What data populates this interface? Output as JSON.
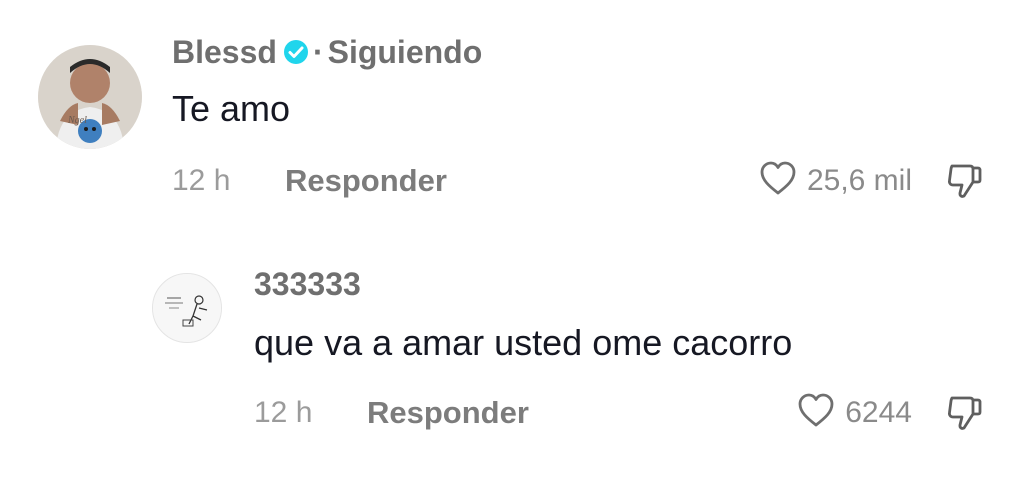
{
  "comments": [
    {
      "username": "Blessd",
      "follow_status": "Siguiendo",
      "separator": "·",
      "text": "Te amo",
      "time": "12 h",
      "reply_label": "Responder",
      "likes": "25,6 mil",
      "verified": true,
      "avatar_icon": "profile-photo-icon"
    },
    {
      "username": "333333",
      "text": "que va a amar usted ome cacorro",
      "time": "12 h",
      "reply_label": "Responder",
      "likes": "6244",
      "avatar_icon": "sketch-avatar-icon"
    }
  ],
  "colors": {
    "verified_blue": "#20d5ec",
    "muted_text": "#8a8a8a",
    "main_text": "#161823"
  },
  "icons": [
    "heart-icon",
    "thumbs-down-icon",
    "verified-badge-icon"
  ]
}
